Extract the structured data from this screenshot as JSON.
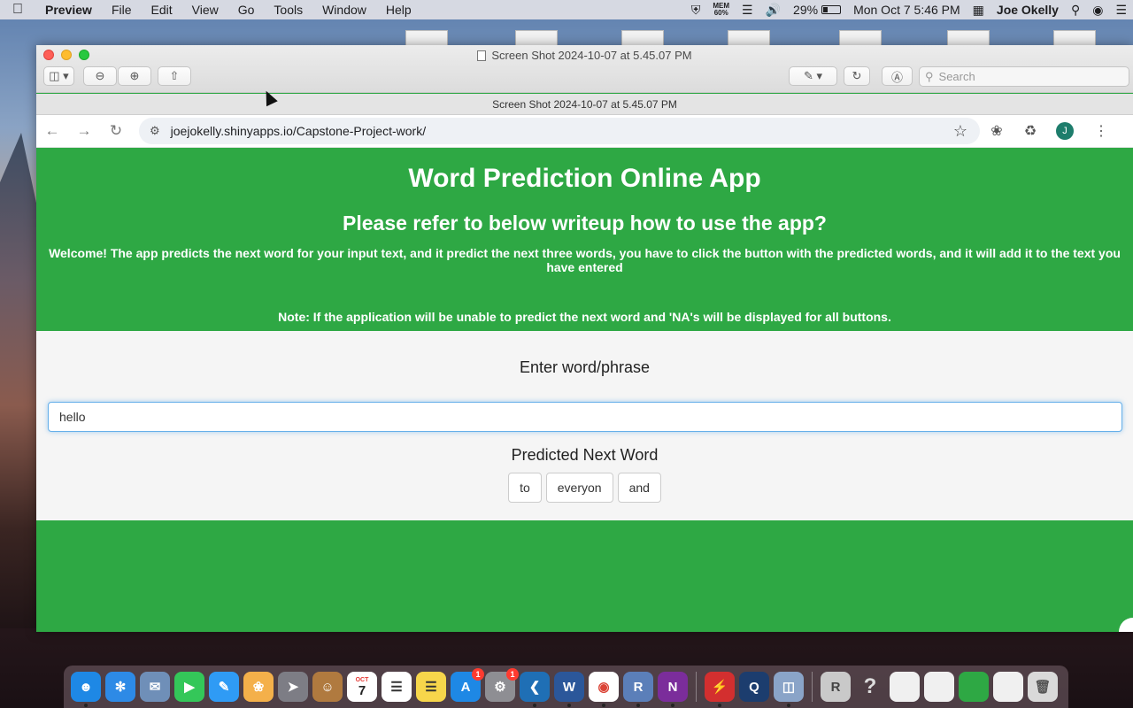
{
  "menubar": {
    "app_name": "Preview",
    "menus": [
      "File",
      "Edit",
      "View",
      "Go",
      "Tools",
      "Window",
      "Help"
    ],
    "mem_label": "MEM",
    "mem_value": "60%",
    "battery": "29%",
    "datetime": "Mon Oct 7  5:46 PM",
    "user": "Joe Okelly"
  },
  "window": {
    "title": "Screen Shot 2024-10-07 at 5.45.07 PM",
    "subtitle": "Screen Shot 2024-10-07 at 5.45.07 PM",
    "search_placeholder": "Search"
  },
  "browser": {
    "url": "joejokelly.shinyapps.io/Capstone-Project-work/",
    "avatar_initial": "J"
  },
  "app": {
    "title": "Word Prediction Online App",
    "subtitle": "Please refer to below writeup how to use the app?",
    "welcome": "Welcome! The app predicts the next word for your input text, and it predict the next three words, you have to click the button with the predicted words, and it will add it to the text you have entered",
    "note": "Note: If the application will be unable to predict the next word and 'NA's will be displayed for all buttons.",
    "input_label": "Enter word/phrase",
    "input_value": "hello",
    "prediction_label": "Predicted Next Word",
    "predictions": [
      "to",
      "everyon",
      "and"
    ],
    "colors": {
      "header_green": "#2ea844",
      "panel_bg": "#f5f5f5"
    }
  },
  "dock": {
    "calendar_day": "7",
    "calendar_month": "OCT",
    "badge_appstore": "1",
    "badge_settings": "1"
  }
}
